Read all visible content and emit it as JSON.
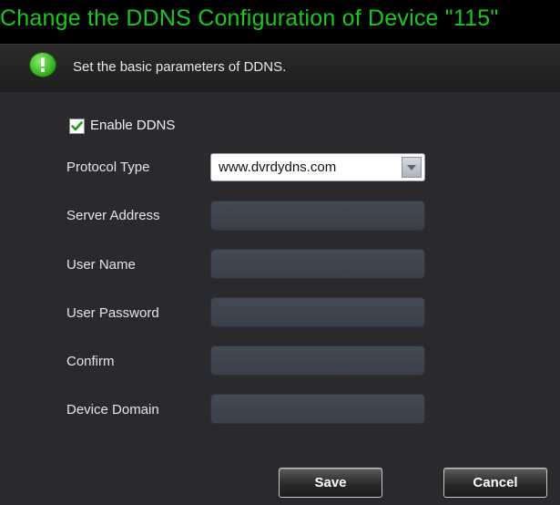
{
  "dialog": {
    "title": "Change the DDNS Configuration of Device \"115\"",
    "info_text": "Set the basic parameters of DDNS.",
    "info_icon": "info-icon"
  },
  "form": {
    "enable_label": "Enable DDNS",
    "enable_checked": true,
    "protocol_label": "Protocol Type",
    "protocol_value": "www.dvrdydns.com",
    "server_address_label": "Server Address",
    "server_address_value": "",
    "user_name_label": "User Name",
    "user_name_value": "",
    "user_password_label": "User Password",
    "user_password_value": "",
    "confirm_label": "Confirm",
    "confirm_value": "",
    "device_domain_label": "Device Domain",
    "device_domain_value": ""
  },
  "buttons": {
    "save_label": "Save",
    "cancel_label": "Cancel"
  },
  "colors": {
    "title": "#19c81e",
    "background": "#000000",
    "panel": "#2a2a2e",
    "field": "#3f444d"
  }
}
